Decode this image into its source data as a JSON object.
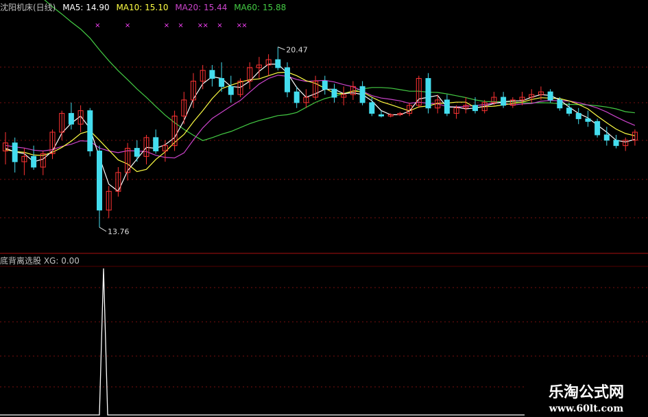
{
  "legend": {
    "name": "沈阳机床(日线)",
    "items": [
      {
        "label": "MA5: 14.90",
        "color": "#ffffff"
      },
      {
        "label": "MA10: 15.10",
        "color": "#ffff44"
      },
      {
        "label": "MA20: 15.44",
        "color": "#cc44cc"
      },
      {
        "label": "MA60: 15.88",
        "color": "#44cc44"
      }
    ]
  },
  "sub_legend": "底背离选股 XG: 0.00",
  "watermark": {
    "title": "乐淘公式网",
    "url": "www.60lt.com"
  },
  "colors": {
    "up": "#ff3333",
    "down": "#44ddee",
    "ma5": "#ffffff",
    "ma10": "#ffff44",
    "ma20": "#cc44cc",
    "ma60": "#44cc44",
    "marker": "#ff44ff",
    "grid": "#7a1010",
    "xg": "#ffffff"
  },
  "chart_data": {
    "type": "candlestick",
    "annotations": [
      {
        "label": "20.47",
        "type": "high",
        "index": 29
      },
      {
        "label": "13.76",
        "type": "low",
        "index": 10
      }
    ],
    "candles": [
      [
        16.6,
        17.3,
        16.1,
        16.9
      ],
      [
        16.9,
        17.1,
        15.8,
        16.2
      ],
      [
        16.2,
        16.7,
        15.7,
        16.4
      ],
      [
        16.4,
        16.8,
        15.9,
        16.0
      ],
      [
        16.0,
        16.6,
        15.7,
        16.5
      ],
      [
        16.5,
        17.4,
        16.3,
        17.3
      ],
      [
        17.3,
        18.1,
        17.0,
        18.0
      ],
      [
        18.0,
        18.4,
        17.4,
        17.6
      ],
      [
        17.6,
        18.3,
        17.3,
        18.1
      ],
      [
        18.1,
        18.2,
        16.4,
        16.6
      ],
      [
        16.6,
        16.8,
        13.76,
        14.4
      ],
      [
        14.4,
        15.3,
        14.1,
        15.1
      ],
      [
        15.1,
        16.0,
        14.9,
        15.8
      ],
      [
        15.8,
        16.9,
        15.5,
        16.7
      ],
      [
        16.7,
        17.0,
        16.2,
        16.4
      ],
      [
        16.4,
        17.2,
        16.1,
        17.1
      ],
      [
        17.1,
        17.4,
        16.5,
        16.6
      ],
      [
        16.6,
        17.0,
        16.2,
        16.8
      ],
      [
        16.8,
        18.1,
        16.6,
        17.9
      ],
      [
        17.9,
        18.8,
        17.6,
        18.5
      ],
      [
        18.5,
        19.5,
        18.2,
        19.2
      ],
      [
        19.2,
        19.8,
        18.9,
        19.6
      ],
      [
        19.6,
        19.8,
        19.0,
        19.3
      ],
      [
        19.3,
        19.9,
        18.8,
        19.0
      ],
      [
        19.0,
        19.4,
        18.4,
        18.7
      ],
      [
        18.7,
        19.3,
        18.6,
        19.2
      ],
      [
        19.2,
        19.9,
        18.9,
        19.7
      ],
      [
        19.7,
        20.1,
        19.3,
        19.8
      ],
      [
        19.8,
        20.2,
        19.4,
        20.0
      ],
      [
        20.0,
        20.47,
        19.6,
        19.7
      ],
      [
        19.7,
        19.9,
        18.6,
        18.8
      ],
      [
        18.8,
        19.0,
        18.2,
        18.4
      ],
      [
        18.4,
        18.9,
        18.2,
        18.6
      ],
      [
        18.6,
        19.4,
        18.5,
        19.2
      ],
      [
        19.2,
        19.4,
        18.7,
        18.9
      ],
      [
        18.9,
        19.1,
        18.4,
        18.6
      ],
      [
        18.6,
        19.0,
        18.3,
        18.7
      ],
      [
        18.7,
        19.2,
        18.5,
        19.0
      ],
      [
        19.0,
        19.2,
        18.3,
        18.4
      ],
      [
        18.4,
        18.6,
        17.9,
        18.0
      ],
      [
        17.95,
        18.1,
        17.85,
        17.9
      ],
      [
        17.9,
        18.0,
        17.85,
        17.95
      ],
      [
        17.95,
        18.05,
        17.9,
        18.0
      ],
      [
        18.0,
        18.4,
        17.9,
        18.3
      ],
      [
        18.3,
        19.4,
        18.2,
        19.3
      ],
      [
        19.3,
        19.5,
        18.0,
        18.2
      ],
      [
        18.2,
        18.7,
        18.0,
        18.5
      ],
      [
        18.5,
        18.7,
        17.9,
        18.0
      ],
      [
        18.0,
        18.3,
        17.8,
        18.2
      ],
      [
        18.2,
        18.6,
        18.0,
        18.3
      ],
      [
        18.3,
        18.6,
        18.0,
        18.1
      ],
      [
        18.1,
        18.5,
        18.0,
        18.4
      ],
      [
        18.4,
        18.8,
        18.3,
        18.6
      ],
      [
        18.6,
        18.8,
        18.2,
        18.3
      ],
      [
        18.3,
        18.6,
        18.2,
        18.5
      ],
      [
        18.5,
        18.8,
        18.3,
        18.6
      ],
      [
        18.6,
        18.9,
        18.4,
        18.7
      ],
      [
        18.7,
        19.0,
        18.5,
        18.8
      ],
      [
        18.8,
        18.9,
        18.4,
        18.5
      ],
      [
        18.5,
        18.6,
        18.1,
        18.2
      ],
      [
        18.2,
        18.4,
        17.9,
        18.0
      ],
      [
        18.0,
        18.2,
        17.6,
        17.8
      ],
      [
        17.8,
        18.1,
        17.5,
        17.7
      ],
      [
        17.7,
        17.8,
        17.1,
        17.2
      ],
      [
        17.2,
        17.5,
        16.8,
        17.0
      ],
      [
        17.0,
        17.2,
        16.7,
        16.8
      ],
      [
        16.8,
        17.1,
        16.6,
        17.0
      ],
      [
        17.0,
        17.4,
        16.8,
        17.3
      ]
    ],
    "markers": [
      9,
      13,
      17,
      18,
      20,
      21,
      22,
      24,
      25
    ],
    "xg_spike": {
      "index": 10,
      "value": 1
    },
    "xg_legend": "XG: 0.00"
  }
}
